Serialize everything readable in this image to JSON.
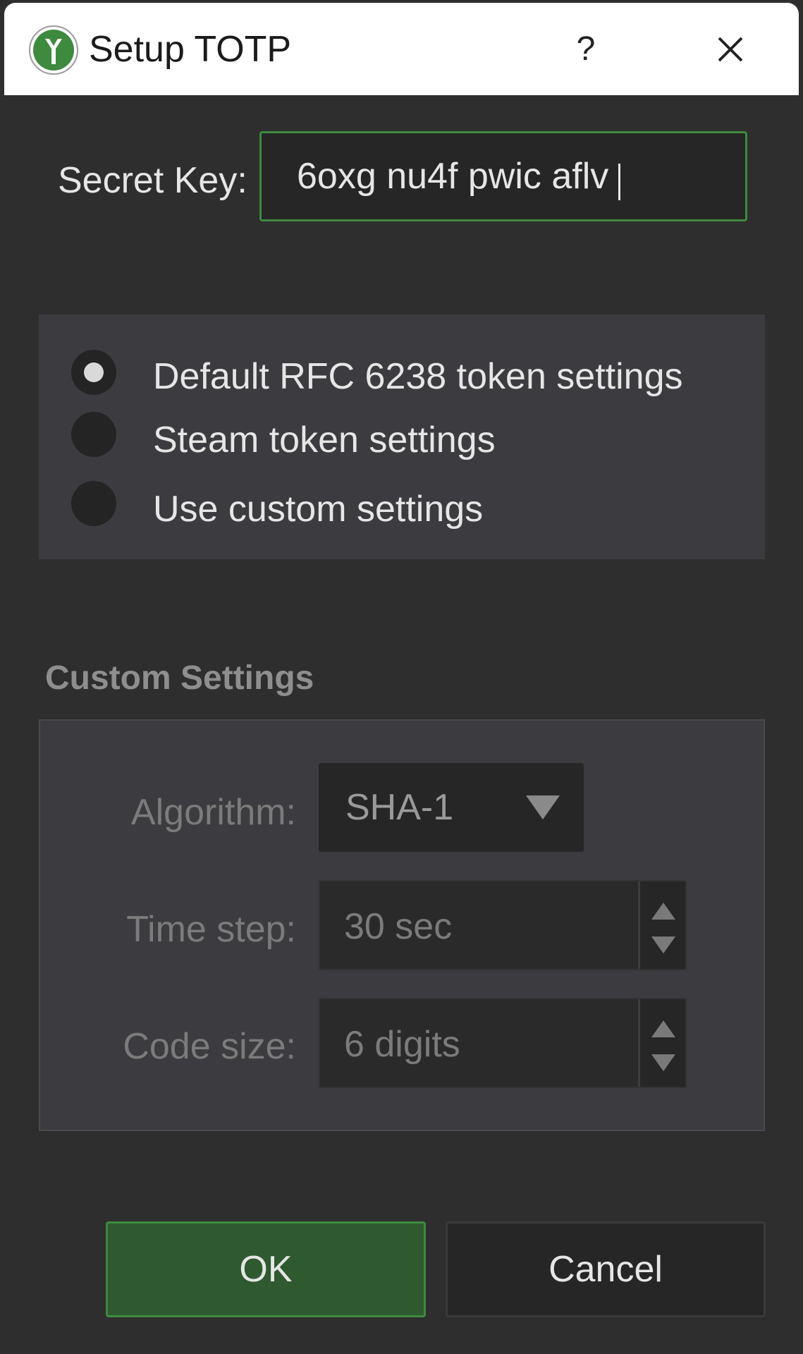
{
  "window": {
    "title": "Setup TOTP",
    "help_label": "?"
  },
  "secret": {
    "label": "Secret Key:",
    "value": "6oxg nu4f pwic aflv"
  },
  "presets": {
    "options": [
      {
        "label": "Default RFC 6238 token settings",
        "selected": true
      },
      {
        "label": "Steam token settings",
        "selected": false
      },
      {
        "label": "Use custom settings",
        "selected": false
      }
    ]
  },
  "custom": {
    "title": "Custom Settings",
    "algorithm_label": "Algorithm:",
    "algorithm_value": "SHA-1",
    "time_step_label": "Time step:",
    "time_step_value": "30 sec",
    "code_size_label": "Code size:",
    "code_size_value": "6 digits"
  },
  "buttons": {
    "ok": "OK",
    "cancel": "Cancel"
  },
  "colors": {
    "accent": "#3e8a3e",
    "ok_background": "#2f5a2f"
  }
}
